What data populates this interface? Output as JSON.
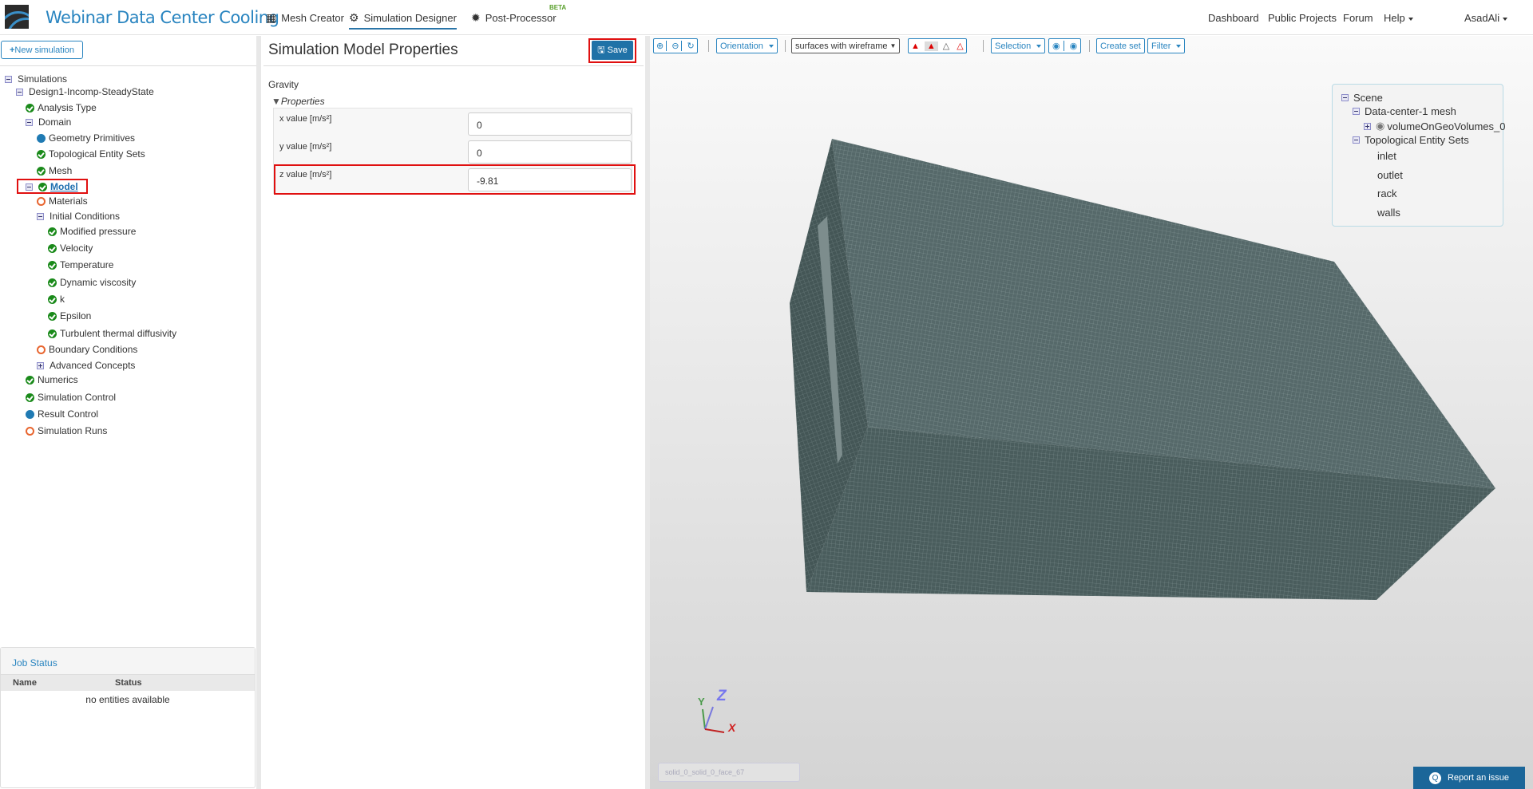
{
  "header": {
    "title": "Webinar Data Center Cooling",
    "tabs": [
      {
        "label": "Mesh Creator",
        "icon": "grid-icon"
      },
      {
        "label": "Simulation Designer",
        "icon": "gears-icon",
        "active": true
      },
      {
        "label": "Post-Processor",
        "icon": "gear-icon",
        "badge": "BETA"
      }
    ],
    "right": [
      "Dashboard",
      "Public Projects",
      "Forum",
      "Help"
    ],
    "user": "AsadAli"
  },
  "sidebar": {
    "new_button": "New simulation",
    "tree": [
      {
        "label": "Simulations",
        "level": 0,
        "icon": "collapse"
      },
      {
        "label": "Design1-Incomp-SteadyState",
        "level": 1,
        "icon": "collapse"
      },
      {
        "label": "Analysis Type",
        "level": 2,
        "icon": "ok"
      },
      {
        "label": "Domain",
        "level": 2,
        "icon": "collapse"
      },
      {
        "label": "Geometry Primitives",
        "level": 3,
        "icon": "blue"
      },
      {
        "label": "Topological Entity Sets",
        "level": 3,
        "icon": "ok"
      },
      {
        "label": "Mesh",
        "level": 3,
        "icon": "ok"
      },
      {
        "label": "Model",
        "level": 2,
        "icon": "ok",
        "selected": true
      },
      {
        "label": "Materials",
        "level": 3,
        "icon": "ring"
      },
      {
        "label": "Initial Conditions",
        "level": 3,
        "icon": "collapse"
      },
      {
        "label": "Modified pressure",
        "level": 4,
        "icon": "ok"
      },
      {
        "label": "Velocity",
        "level": 4,
        "icon": "ok"
      },
      {
        "label": "Temperature",
        "level": 4,
        "icon": "ok"
      },
      {
        "label": "Dynamic viscosity",
        "level": 4,
        "icon": "ok"
      },
      {
        "label": "k",
        "level": 4,
        "icon": "ok"
      },
      {
        "label": "Epsilon",
        "level": 4,
        "icon": "ok"
      },
      {
        "label": "Turbulent thermal diffusivity",
        "level": 4,
        "icon": "ok"
      },
      {
        "label": "Boundary Conditions",
        "level": 3,
        "icon": "ring"
      },
      {
        "label": "Advanced Concepts",
        "level": 3,
        "icon": "expand"
      },
      {
        "label": "Numerics",
        "level": 2,
        "icon": "ok"
      },
      {
        "label": "Simulation Control",
        "level": 2,
        "icon": "ok"
      },
      {
        "label": "Result Control",
        "level": 2,
        "icon": "blue"
      },
      {
        "label": "Simulation Runs",
        "level": 2,
        "icon": "ring"
      }
    ],
    "job_status": {
      "title": "Job Status",
      "columns": [
        "Name",
        "Status"
      ],
      "empty": "no entities available"
    }
  },
  "properties": {
    "title": "Simulation Model Properties",
    "save": "Save",
    "section": "Gravity",
    "group": "Properties",
    "fields": [
      {
        "label": "x value [m/s²]",
        "value": "0"
      },
      {
        "label": "y value [m/s²]",
        "value": "0"
      },
      {
        "label": "z value [m/s²]",
        "value": "-9.81"
      }
    ]
  },
  "viewer": {
    "toolbar": {
      "orientation": "Orientation",
      "render_mode": "surfaces with wireframe",
      "selection": "Selection",
      "create_set": "Create set",
      "filter": "Filter"
    },
    "scene": {
      "root": "Scene",
      "mesh": "Data-center-1 mesh",
      "volume": "volumeOnGeoVolumes_0",
      "sets_label": "Topological Entity Sets",
      "sets": [
        "inlet",
        "outlet",
        "rack",
        "walls"
      ]
    },
    "axes": {
      "x": "X",
      "y": "Y",
      "z": "Z"
    },
    "hover_face": "solid_0_solid_0_face_67",
    "report": "Report an issue"
  }
}
